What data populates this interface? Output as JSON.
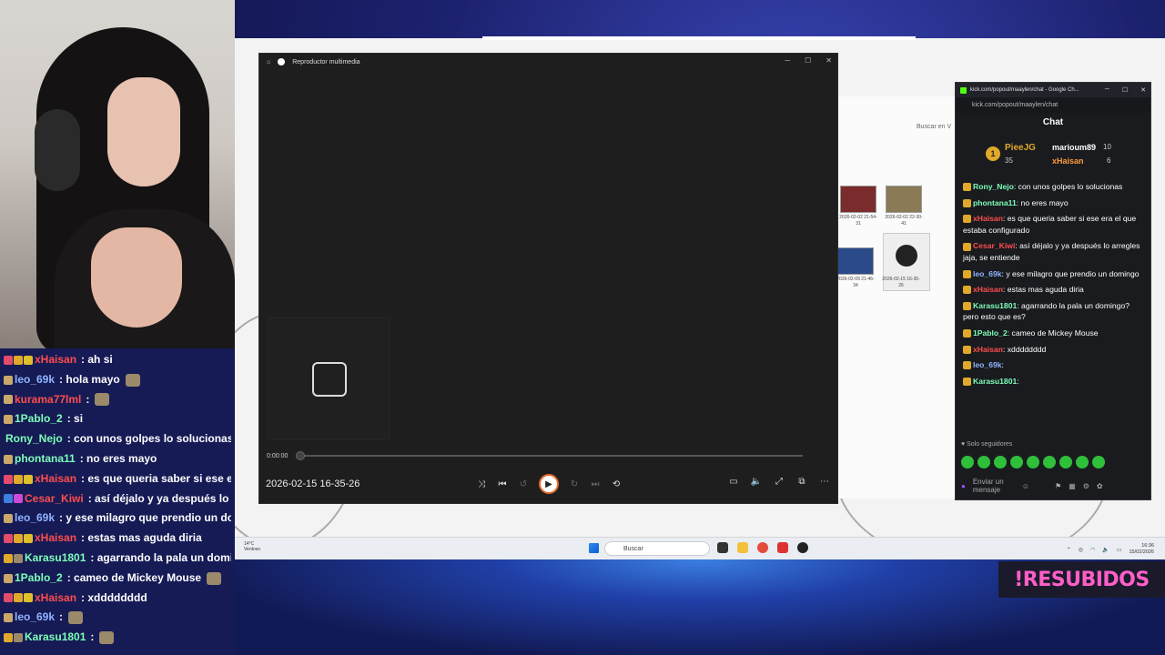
{
  "left_chat": [
    {
      "user": "xHaisan",
      "color": "#ff4d4d",
      "badges": [
        "#e34b6c",
        "#e0a92a",
        "#e0c02a"
      ],
      "text": ": ah si",
      "emote": false
    },
    {
      "user": "leo_69k",
      "color": "#8fb4ff",
      "badges": [
        "#c9a86a"
      ],
      "text": ": hola mayo",
      "emote": true
    },
    {
      "user": "kurama77lml",
      "color": "#ff4d4d",
      "badges": [
        "#c9a86a"
      ],
      "text": ":",
      "emote": true
    },
    {
      "user": "1Pablo_2",
      "color": "#7dffb8",
      "badges": [
        "#c9a86a"
      ],
      "text": ": si",
      "emote": false
    },
    {
      "user": "Rony_Nejo",
      "color": "#7dffb8",
      "badges": [],
      "text": ": con unos golpes lo solucionas",
      "emote": false
    },
    {
      "user": "phontana11",
      "color": "#7dffb8",
      "badges": [
        "#c9a86a"
      ],
      "text": ": no eres mayo",
      "emote": false
    },
    {
      "user": "xHaisan",
      "color": "#ff4d4d",
      "badges": [
        "#e34b6c",
        "#e0a92a",
        "#e0c02a"
      ],
      "text": ": es que queria saber si ese era",
      "emote": false
    },
    {
      "user": "Cesar_Kiwi",
      "color": "#ff4d4d",
      "badges": [
        "#3b7fe0",
        "#c94bd6"
      ],
      "text": ": así déjalo y ya después lo arre",
      "emote": false
    },
    {
      "user": "leo_69k",
      "color": "#8fb4ff",
      "badges": [
        "#c9a86a"
      ],
      "text": ": y ese milagro que prendio un domin",
      "emote": false
    },
    {
      "user": "xHaisan",
      "color": "#ff4d4d",
      "badges": [
        "#e34b6c",
        "#e0a92a",
        "#e0c02a"
      ],
      "text": ": estas mas aguda diria",
      "emote": false
    },
    {
      "user": "Karasu1801",
      "color": "#7dffb8",
      "badges": [
        "#e0a92a",
        "#9a8a6a"
      ],
      "text": ": agarrando la pala un doming",
      "emote": false
    },
    {
      "user": "1Pablo_2",
      "color": "#7dffb8",
      "badges": [
        "#c9a86a"
      ],
      "text": ": cameo de Mickey Mouse",
      "emote": true
    },
    {
      "user": "xHaisan",
      "color": "#ff4d4d",
      "badges": [
        "#e34b6c",
        "#e0a92a",
        "#e0c02a"
      ],
      "text": ": xdddddddd",
      "emote": false
    },
    {
      "user": "leo_69k",
      "color": "#8fb4ff",
      "badges": [
        "#c9a86a"
      ],
      "text": ":",
      "emote": true
    },
    {
      "user": "Karasu1801",
      "color": "#7dffb8",
      "badges": [
        "#e0a92a",
        "#9a8a6a"
      ],
      "text": ":",
      "emote": true
    }
  ],
  "player": {
    "title": "Reproductor multimedia",
    "time": "0:00:00",
    "file_name": "2026-02-15 16-35-26",
    "controls": [
      "shuffle-icon",
      "previous-icon",
      "rewind-icon",
      "play-icon",
      "forward-icon",
      "next-icon",
      "repeat-icon"
    ],
    "right_controls": [
      "subtitles-icon",
      "volume-icon",
      "fullscreen-icon",
      "miniplayer-icon",
      "more-icon"
    ]
  },
  "explorer": {
    "search_placeholder": "Buscar en V",
    "files": [
      {
        "label": "2026-02-02 21-54-31",
        "color": "#7a2b2b"
      },
      {
        "label": "2026-02-02 22-30-41",
        "color": "#8a7a55"
      },
      {
        "label": "2026-02-09 21-46-34",
        "color": "#2b4a8a"
      },
      {
        "label": "2026-02-15 16-35-26",
        "color": "#eeeeee"
      }
    ]
  },
  "kick": {
    "window_title": "kick.com/popout/maaylen/chat - Google Ch...",
    "url": "kick.com/popout/maaylen/chat",
    "header": "Chat",
    "top_gifters": [
      {
        "rank": "1",
        "name": "PieeJG",
        "count": "35",
        "color": "#e0a92a"
      },
      {
        "name": "marioum89",
        "count": "10",
        "color": "#ffffff"
      },
      {
        "name": "xHaisan",
        "count": "6",
        "color": "#ff9a3c"
      }
    ],
    "messages": [
      {
        "user": "Rony_Nejo",
        "color": "#7dffb8",
        "text": ": con unos golpes lo solucionas"
      },
      {
        "user": "phontana11",
        "color": "#7dffb8",
        "text": ": no eres mayo"
      },
      {
        "user": "xHaisan",
        "color": "#ff4d4d",
        "text": ": es que queria saber si ese era el que estaba configurado"
      },
      {
        "user": "Cesar_Kiwi",
        "color": "#ff4d4d",
        "text": ": así déjalo y ya después lo arregles jaja, se entiende"
      },
      {
        "user": "leo_69k",
        "color": "#8fb4ff",
        "text": ": y ese milagro que prendio un domingo"
      },
      {
        "user": "xHaisan",
        "color": "#ff4d4d",
        "text": ": estas mas aguda diria"
      },
      {
        "user": "Karasu1801",
        "color": "#7dffb8",
        "text": ": agarrando la pala un domingo? pero esto que es?"
      },
      {
        "user": "1Pablo_2",
        "color": "#7dffb8",
        "text": ": cameo de Mickey Mouse"
      },
      {
        "user": "xHaisan",
        "color": "#ff4d4d",
        "text": ": xdddddddd"
      },
      {
        "user": "leo_69k",
        "color": "#8fb4ff",
        "text": ":"
      },
      {
        "user": "Karasu1801",
        "color": "#7dffb8",
        "text": ":"
      }
    ],
    "followers_label": "Solo seguidores",
    "send_placeholder": "Enviar un mensaje"
  },
  "taskbar": {
    "weather_temp": "14°C",
    "weather_text": "Ventoso",
    "search_label": "Buscar",
    "time": "16:36",
    "date": "15/02/2026"
  },
  "overlay_text": "!RESUBIDOS"
}
